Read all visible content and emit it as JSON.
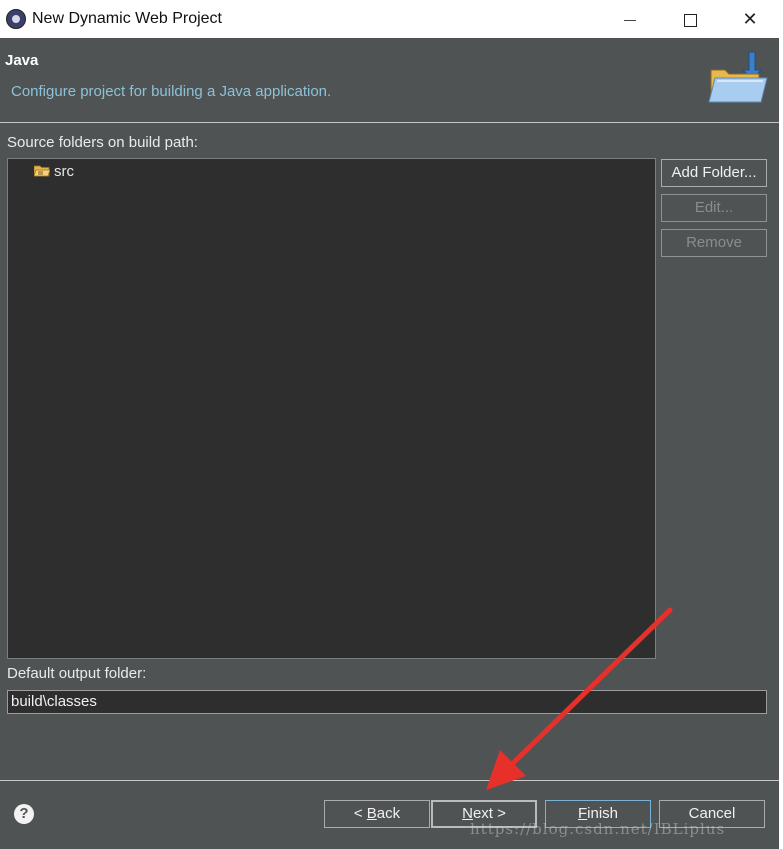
{
  "window": {
    "title": "New Dynamic Web Project"
  },
  "header": {
    "title": "Java",
    "description": "Configure project for building a Java application."
  },
  "source": {
    "label": "Source folders on build path:",
    "items": [
      {
        "label": "src",
        "icon": "source-folder-icon"
      }
    ],
    "buttons": {
      "add_folder": "Add Folder...",
      "edit": "Edit...",
      "remove": "Remove"
    }
  },
  "output": {
    "label": "Default output folder:",
    "value": "build\\classes"
  },
  "footer": {
    "back": {
      "pre": "< ",
      "mnemonic": "B",
      "rest": "ack"
    },
    "next": {
      "mnemonic": "N",
      "rest": "ext >"
    },
    "finish": {
      "mnemonic": "F",
      "rest": "inish"
    },
    "cancel": "Cancel",
    "watermark": "https://blog.csdn.net/IBLiplus"
  },
  "colors": {
    "background": "#505354",
    "panel": "#2e2e2e",
    "description": "#8cc2d8",
    "annotation_arrow": "#e8302a"
  }
}
